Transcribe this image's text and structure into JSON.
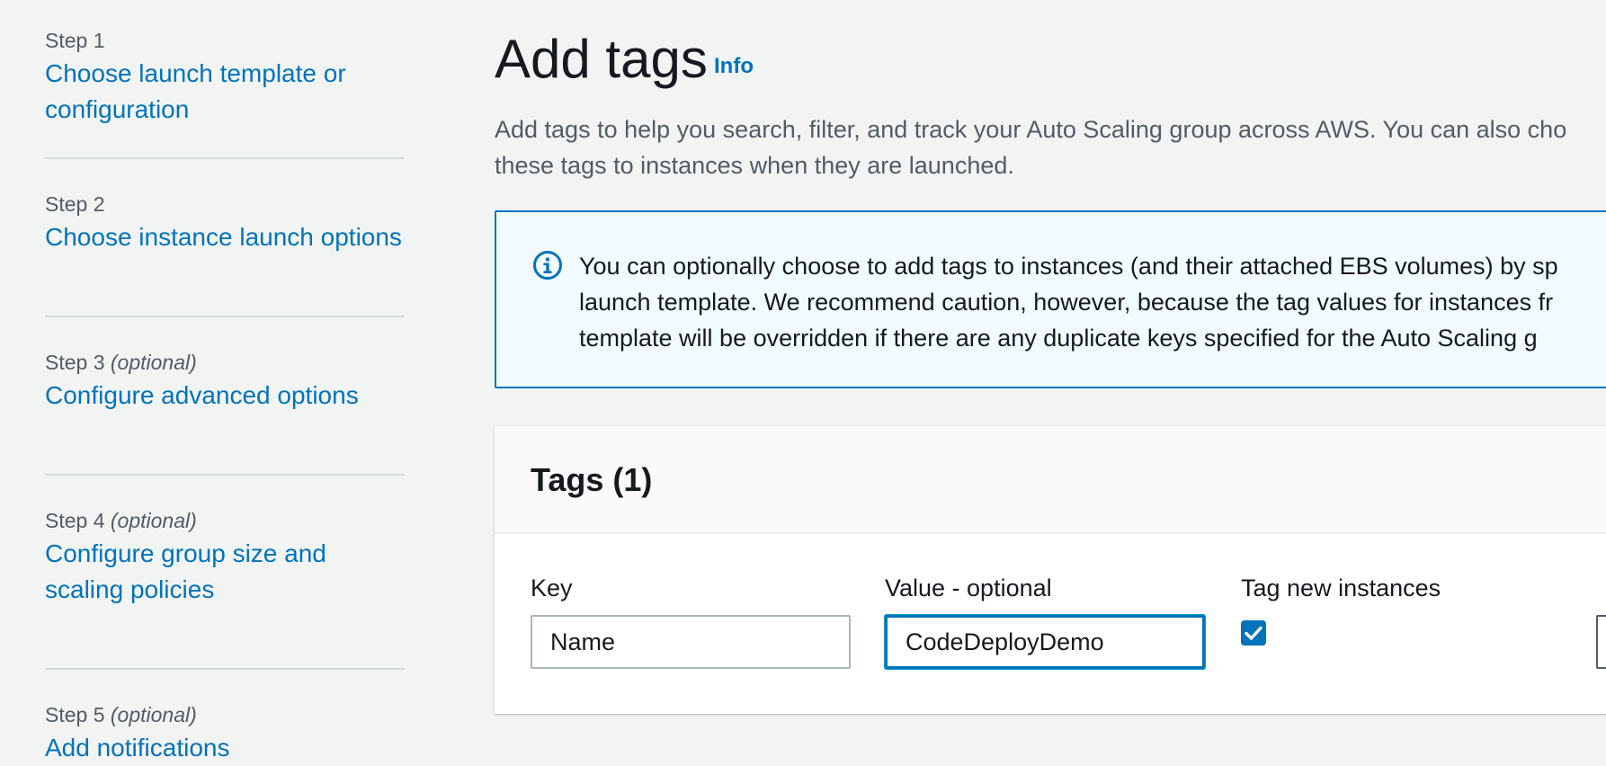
{
  "wizard": {
    "steps": [
      {
        "number": "Step 1",
        "optional": "",
        "label_line1": "Choose launch template or",
        "label_line2": "configuration"
      },
      {
        "number": "Step 2",
        "optional": "",
        "label_line1": "Choose instance launch options",
        "label_line2": ""
      },
      {
        "number": "Step 3",
        "optional": "(optional)",
        "label_line1": "Configure advanced options",
        "label_line2": ""
      },
      {
        "number": "Step 4",
        "optional": "(optional)",
        "label_line1": "Configure group size and",
        "label_line2": "scaling policies"
      },
      {
        "number": "Step 5",
        "optional": "(optional)",
        "label_line1": "Add notifications",
        "label_line2": ""
      }
    ]
  },
  "header": {
    "title": "Add tags",
    "info_link": "Info",
    "description_line1": "Add tags to help you search, filter, and track your Auto Scaling group across AWS. You can also cho",
    "description_line2": "these tags to instances when they are launched."
  },
  "alert": {
    "icon": "info-circle-icon",
    "line1": "You can optionally choose to add tags to instances (and their attached EBS volumes) by sp",
    "line2": "launch template. We recommend caution, however, because the tag values for instances fr",
    "line3": "template will be overridden if there are any duplicate keys specified for the Auto Scaling g"
  },
  "tags": {
    "title": "Tags (1)",
    "key_label": "Key",
    "value_label": "Value - optional",
    "tag_new_instances_label": "Tag new instances",
    "rows": [
      {
        "key": "Name",
        "value": "CodeDeployDemo",
        "tag_new_instances": true
      }
    ]
  },
  "colors": {
    "link": "#0073bb",
    "background": "#f2f3f3",
    "alert_background": "#f1faff",
    "alert_border": "#0073bb"
  }
}
